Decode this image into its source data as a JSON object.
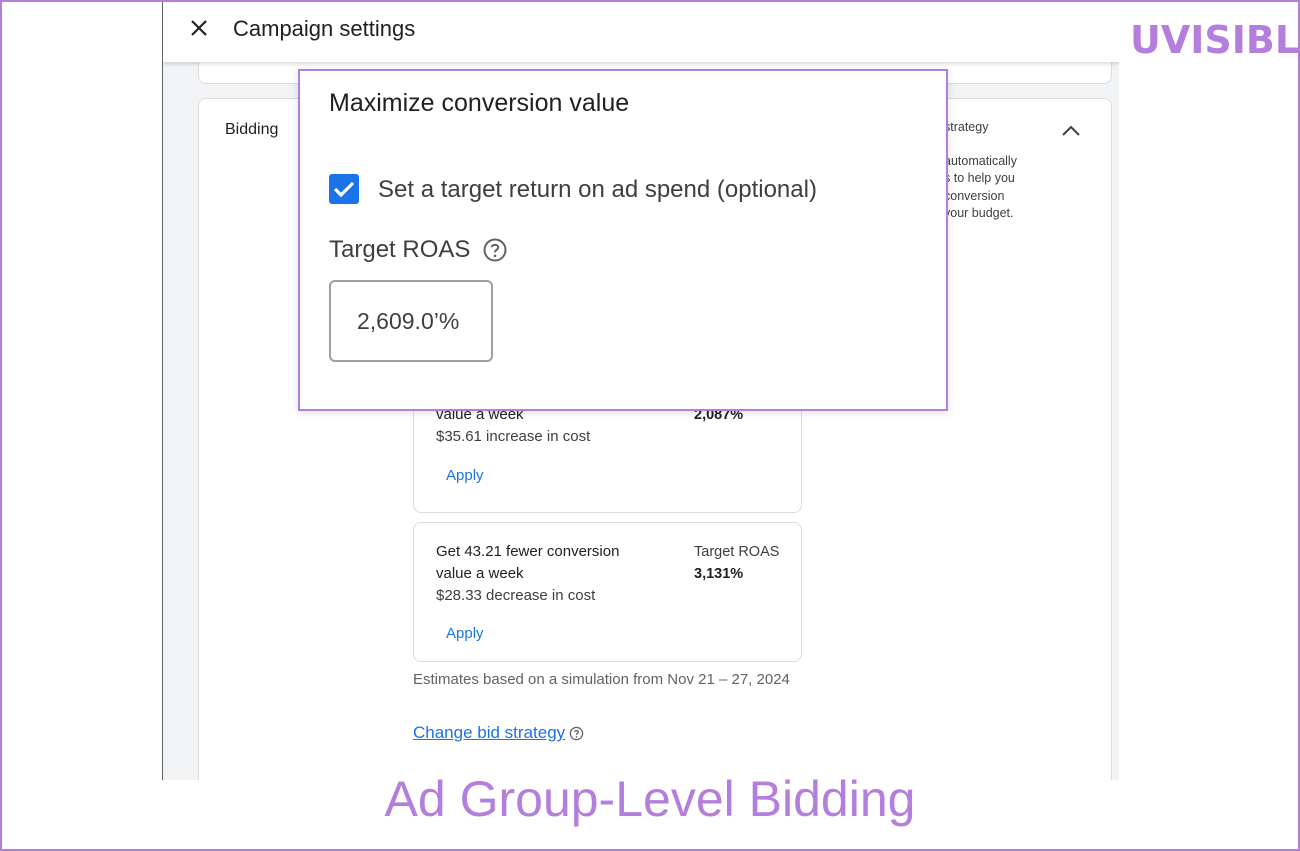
{
  "header": {
    "title": "Campaign settings"
  },
  "section": {
    "label": "Bidding",
    "side_lines": [
      "strategy",
      "automatically",
      "s to help you",
      "conversion",
      "your budget."
    ]
  },
  "popup": {
    "title": "Maximize conversion value",
    "checkbox_label": "Set a target return on ad spend (optional)",
    "checkbox_checked": true,
    "roas_label": "Target ROAS",
    "roas_value": "2,609.0’%"
  },
  "recommendations": [
    {
      "line1": "",
      "line2": "value a week",
      "cost": "$35.61 increase in cost",
      "target_label": "",
      "target_value": "2,087%",
      "apply_label": "Apply"
    },
    {
      "line1": "Get 43.21 fewer conversion",
      "line2": "value a week",
      "cost": "$28.33 decrease in cost",
      "target_label": "Target ROAS",
      "target_value": "3,131%",
      "apply_label": "Apply"
    }
  ],
  "estimates": "Estimates based on a simulation from Nov 21 – 27, 2024",
  "change_bid_strategy": "Change bid strategy",
  "brand": {
    "logo_text": "UVISIBLE",
    "accent": "#b47fdc"
  },
  "caption": "Ad Group-Level Bidding",
  "colors": {
    "link": "#1a73e8",
    "checkbox": "#1a73e8"
  }
}
